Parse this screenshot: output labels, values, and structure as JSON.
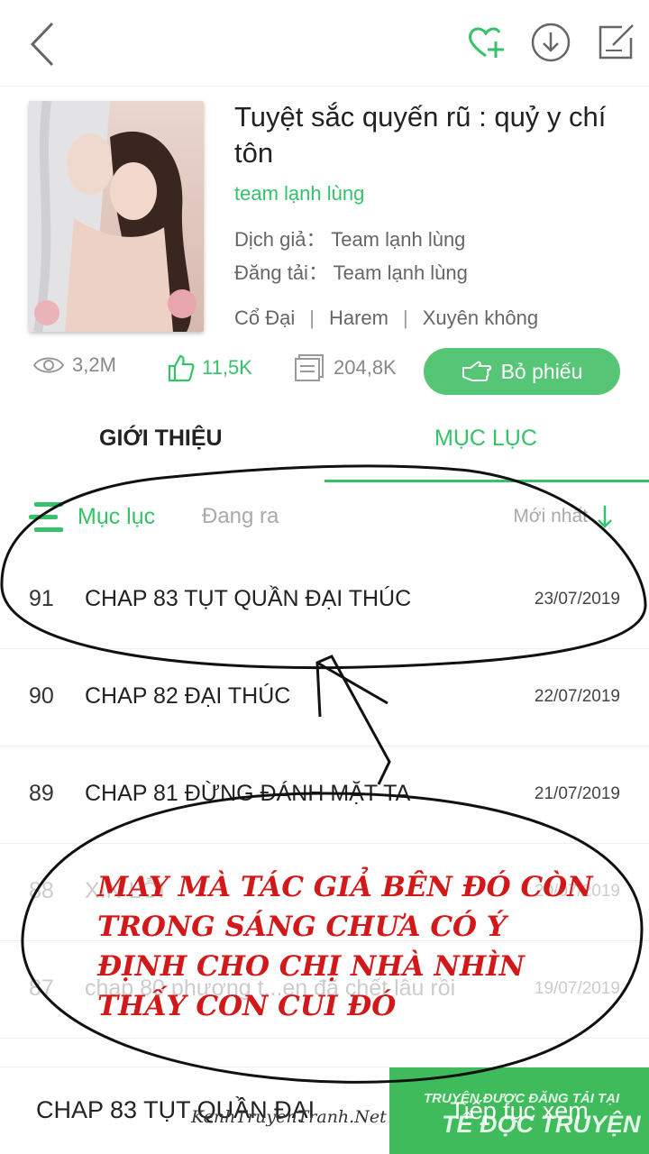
{
  "header": {
    "icons": [
      "back-arrow-icon",
      "heart-plus-icon",
      "download-icon",
      "edit-icon"
    ]
  },
  "manga": {
    "title": "Tuyệt sắc quyến rũ : quỷ y chí tôn",
    "team": "team lạnh lùng",
    "translator_label": "Dịch giả：",
    "translator": "Team lạnh lùng",
    "uploader_label": "Đăng tải：",
    "uploader": "Team lạnh lùng",
    "genres": [
      "Cổ Đại",
      "Harem",
      "Xuyên không"
    ]
  },
  "stats": {
    "views": "3,2M",
    "likes": "11,5K",
    "tickets": "204,8K",
    "vote_label": "Bỏ phiếu"
  },
  "tabs": {
    "intro": "GIỚI THIỆU",
    "toc": "MỤC LỤC"
  },
  "filter": {
    "active": "Mục lục",
    "ongoing": "Đang ra",
    "sort": "Mới nhất"
  },
  "chapters": [
    {
      "num": "91",
      "title": "CHAP 83 TỤT QUẦN ĐẠI THÚC",
      "date": "23/07/2019"
    },
    {
      "num": "90",
      "title": "CHAP 82 ĐẠI THÚC",
      "date": "22/07/2019"
    },
    {
      "num": "89",
      "title": "CHAP 81 ĐỪNG ĐÁNH MẶT TA",
      "date": "21/07/2019"
    },
    {
      "num": "88",
      "title": "XIN LỖI",
      "date": "20/07/2019"
    },
    {
      "num": "87",
      "title": "chap 80 phượng t...en đã chết lâu rồi",
      "date": "19/07/2019"
    }
  ],
  "bottom": {
    "current": "CHAP 83 TỤT QUẦN ĐẠI",
    "continue": "Tiếp tục xem",
    "watermark_top": "TRUYỆN ĐƯỢC ĐĂNG TẢI TẠI",
    "watermark_main": "TỂ ĐỌC TRUYỆN",
    "watermark_site": "KenhTruyenTranh.Net"
  },
  "annotation": {
    "text": "MAY MÀ TÁC GIẢ BÊN ĐÓ CÒN TRONG SÁNG CHƯA CÓ Ý ĐỊNH CHO CHỊ NHÀ NHÌN THẤY CON CUI ĐÓ"
  },
  "colors": {
    "accent": "#36c26a",
    "button": "#56c676",
    "annotation": "#d21818"
  }
}
